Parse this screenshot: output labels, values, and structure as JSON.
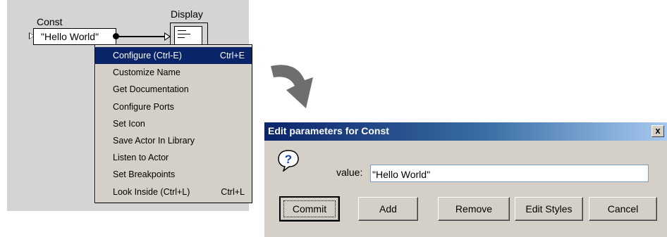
{
  "canvas": {
    "const_label": "Const",
    "display_label": "Display",
    "const_value": "\"Hello World\""
  },
  "menu": {
    "items": [
      {
        "label": "Configure (Ctrl-E)",
        "shortcut": "Ctrl+E"
      },
      {
        "label": "Customize Name",
        "shortcut": ""
      },
      {
        "label": "Get Documentation",
        "shortcut": ""
      },
      {
        "label": "Configure Ports",
        "shortcut": ""
      },
      {
        "label": "Set Icon",
        "shortcut": ""
      },
      {
        "label": "Save Actor In Library",
        "shortcut": ""
      },
      {
        "label": "Listen to Actor",
        "shortcut": ""
      },
      {
        "label": "Set Breakpoints",
        "shortcut": ""
      },
      {
        "label": "Look Inside (Ctrl+L)",
        "shortcut": "Ctrl+L"
      }
    ]
  },
  "dialog": {
    "title": "Edit parameters for Const",
    "close_label": "x",
    "value_label": "value:",
    "value": "\"Hello World\"",
    "buttons": {
      "commit": "Commit",
      "add": "Add",
      "remove": "Remove",
      "edit_styles": "Edit Styles",
      "cancel": "Cancel"
    }
  },
  "icons": {
    "question": "question-icon",
    "arrow": "curved-arrow-icon"
  },
  "colors": {
    "menu_selected_bg": "#0a246a",
    "titlebar_start": "#0a246a",
    "titlebar_end": "#a6caf0",
    "canvas_bg": "#d4d4d4"
  }
}
